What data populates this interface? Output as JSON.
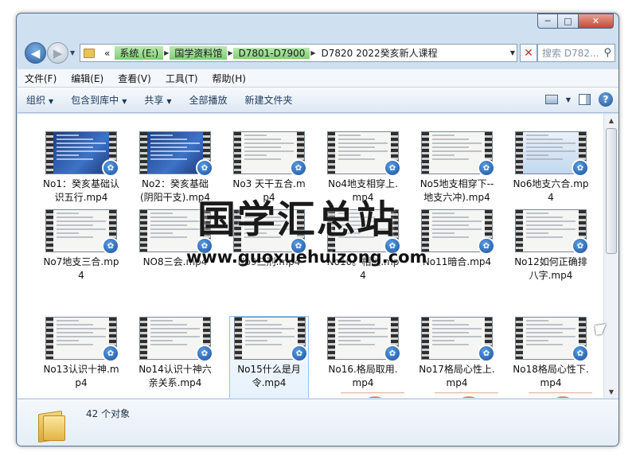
{
  "window": {
    "controls": {
      "minimize": "─",
      "maximize": "□",
      "close": "✕"
    }
  },
  "nav": {
    "back_glyph": "◀",
    "forward_glyph": "▶",
    "history_glyph": "▼"
  },
  "address": {
    "prefix": "«",
    "crumbs": [
      "系统 (E:)",
      "国学资料馆",
      "D7801-D7900",
      "D7820 2022癸亥新人课程"
    ],
    "separator": "▶",
    "dropdown": "▼",
    "refresh_glyph": "✕"
  },
  "search": {
    "placeholder": "搜索 D782...",
    "icon": "search-icon"
  },
  "menu": [
    "文件(F)",
    "编辑(E)",
    "查看(V)",
    "工具(T)",
    "帮助(H)"
  ],
  "toolbar": {
    "organize": "组织",
    "include_library": "包含到库中",
    "share": "共享",
    "play_all": "全部播放",
    "new_folder": "新建文件夹",
    "dropdown": "▼",
    "help": "?"
  },
  "files": [
    {
      "name": "No1：癸亥基础认识五行.mp4",
      "thumb": "blue"
    },
    {
      "name": "No2：癸亥基础(阴阳干支).mp4",
      "thumb": "blue"
    },
    {
      "name": "No3 天干五合.mp4",
      "thumb": "doc"
    },
    {
      "name": "No4地支相穿上.mp4",
      "thumb": "doc"
    },
    {
      "name": "No5地支相穿下--地支六冲).mp4",
      "thumb": "doc"
    },
    {
      "name": "No6地支六合.mp4",
      "thumb": "desk"
    },
    {
      "name": "No7地支三合.mp4",
      "thumb": "doc"
    },
    {
      "name": "NO8三会.mp4",
      "thumb": "doc"
    },
    {
      "name": "No9三刑.mp4",
      "thumb": "doc"
    },
    {
      "name": "No10。相破.mp4",
      "thumb": "doc"
    },
    {
      "name": "No11暗合.mp4",
      "thumb": "doc"
    },
    {
      "name": "No12如何正确排八字.mp4",
      "thumb": "doc"
    },
    {
      "name": "No13认识十神.mp4",
      "thumb": "doc"
    },
    {
      "name": "No14认识十神六亲关系.mp4",
      "thumb": "doc"
    },
    {
      "name": "No15什么是月令.mp4",
      "thumb": "doc",
      "selected": true
    },
    {
      "name": "No16.格局取用.mp4",
      "thumb": "doc"
    },
    {
      "name": "No17格局心性上.mp4",
      "thumb": "doc"
    },
    {
      "name": "No18格局心性下.mp4",
      "thumb": "doc"
    }
  ],
  "status": {
    "count": "42 个对象"
  },
  "watermark": {
    "title": "国学汇总站",
    "url": "www.guoxuehuizong.com"
  },
  "scrollbar": {
    "up": "▲",
    "down": "▼"
  }
}
